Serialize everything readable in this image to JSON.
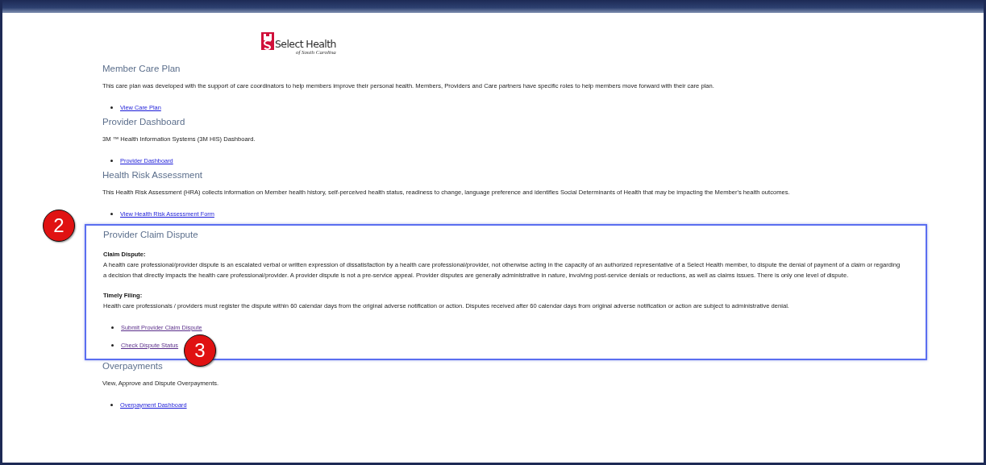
{
  "logo": {
    "name": "Select Health",
    "tagline": "of South Carolina"
  },
  "sections": [
    {
      "heading": "Member Care Plan",
      "highlighted": false,
      "blocks": [
        {
          "text": "This care plan was developed with the support of care coordinators to help members improve their personal health. Members, Providers and Care partners have specific roles to help members move forward with their care plan."
        }
      ],
      "links": [
        {
          "label": "View Care Plan",
          "visited": false
        }
      ]
    },
    {
      "heading": "Provider Dashboard",
      "highlighted": false,
      "blocks": [
        {
          "text": "3M ™ Health Information Systems (3M HIS) Dashboard."
        }
      ],
      "links": [
        {
          "label": "Provider Dashboard",
          "visited": false
        }
      ]
    },
    {
      "heading": "Health Risk Assessment",
      "highlighted": false,
      "blocks": [
        {
          "text": "This Health Risk Assessment (HRA) collects information on Member health history, self-perceived health status, readiness to change, language preference and identifies Social Determinants of Health that may be impacting the Member's health outcomes."
        }
      ],
      "links": [
        {
          "label": "View Health Risk Assessment Form",
          "visited": false
        }
      ]
    },
    {
      "heading": "Provider Claim Dispute",
      "highlighted": true,
      "callout": "2",
      "blocks": [
        {
          "subheading": "Claim Dispute:",
          "text": "A health care professional/provider dispute is an escalated verbal or written expression of dissatisfaction by a health care professional/provider, not otherwise acting in the capacity of an authorized representative of a Select Health member, to dispute the denial of payment of a claim or regarding a decision that directly impacts the health care professional/provider. A provider dispute is not a pre-service appeal. Provider disputes are generally administrative in nature, involving post-service denials or reductions, as well as claims issues. There is only one level of dispute."
        },
        {
          "subheading": "Timely Filing:",
          "text": "Health care professionals / providers must register the dispute within 60 calendar days from the original adverse notification or action. Disputes received after 60 calendar days from original adverse notification or action are subject to administrative denial."
        }
      ],
      "links": [
        {
          "label": "Submit Provider Claim Dispute",
          "visited": true
        },
        {
          "label": "Check Dispute Status",
          "visited": true,
          "callout": "3"
        }
      ]
    },
    {
      "heading": "Overpayments",
      "highlighted": false,
      "blocks": [
        {
          "text": "View, Approve and Dispute Overpayments."
        }
      ],
      "links": [
        {
          "label": "Overpayment Dashboard",
          "visited": false
        }
      ]
    }
  ]
}
